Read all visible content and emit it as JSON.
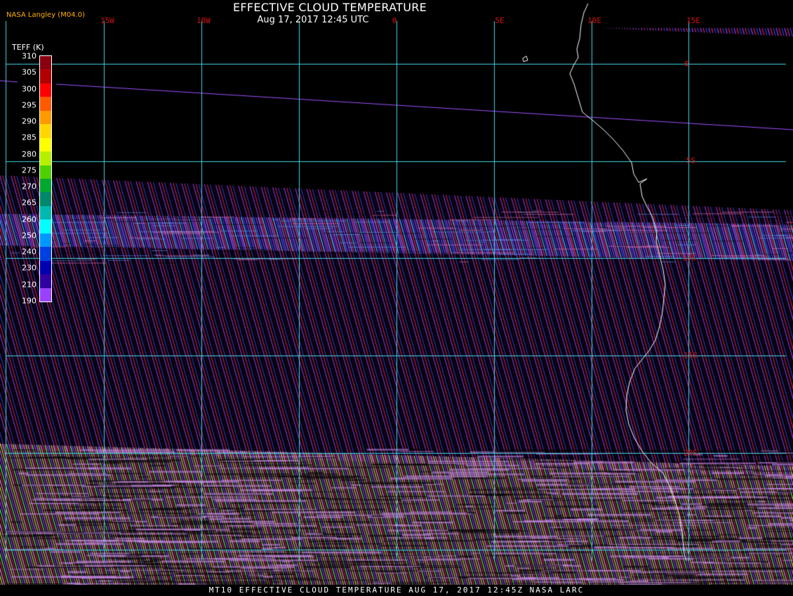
{
  "header": {
    "title": "EFFECTIVE CLOUD TEMPERATURE",
    "datetime": "Aug 17, 2017 12:45 UTC",
    "credit": "NASA Langley (M04.0)"
  },
  "footer": {
    "text": "MT10  EFFECTIVE CLOUD TEMPERATURE   AUG 17, 2017 12:45Z   NASA LARC"
  },
  "grid": {
    "lon_labels": [
      "15W",
      "10W",
      "0",
      "5E",
      "10E",
      "15E"
    ],
    "lat_labels": [
      "0",
      "5S",
      "10S",
      "15S",
      "20S"
    ],
    "color": "#3fd7e6",
    "label_color": "#d61010"
  },
  "colorbar": {
    "title": "TEFF (K)",
    "ticks": [
      "310",
      "305",
      "300",
      "295",
      "290",
      "285",
      "280",
      "275",
      "270",
      "265",
      "260",
      "250",
      "240",
      "230",
      "210",
      "190"
    ],
    "colors": [
      "#8a0010",
      "#b00000",
      "#ff0000",
      "#ff5a00",
      "#ff9900",
      "#ffd700",
      "#ffff00",
      "#b6f000",
      "#4fd000",
      "#00a830",
      "#00886a",
      "#00b8b0",
      "#00ffff",
      "#0098ff",
      "#0040e0",
      "#0000b0",
      "#3000a0",
      "#9a40ff"
    ]
  },
  "colors": {
    "coast": "#ffffff",
    "orbit_track": "#a050ff",
    "swath_purple": "#9a40ff",
    "swath_red": "#e02060",
    "swath_blue": "#3040e0",
    "swath_yellow": "#e0e040"
  }
}
